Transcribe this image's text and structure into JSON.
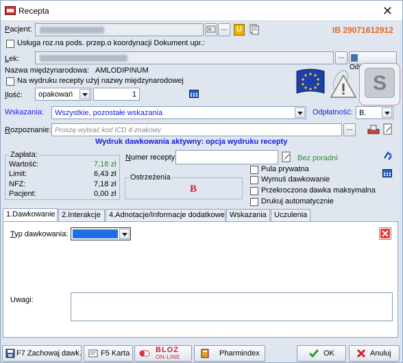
{
  "window": {
    "title": "Recepta",
    "close": "✕"
  },
  "header": {
    "patient_label": "Pacjent:",
    "patient_button": "...",
    "ib_number": "IB 29071612912",
    "usluga_label": "Usługa roz.na pods. przep.o koordynacji Dokument upr.:"
  },
  "drug": {
    "lek_label": "Lek:",
    "lek_button": "...",
    "odpowiedniki_label": "Odpowiedniki",
    "intl_name_label": "Nazwa międzynarodowa:",
    "intl_name_value": "AMLODIPINUM",
    "use_intl_label": "Na wydruku recepty użyj nazwy międzynarodowej",
    "ilosc_label": "Ilość:",
    "unit_value": "opakowań",
    "qty_value": "1",
    "s_badge": "S"
  },
  "indications": {
    "label": "Wskazania:",
    "value": "Wszystkie, pozostałe wskazania",
    "odplatnosc_label": "Odpłatność:",
    "odplatnosc_value": "B."
  },
  "diagnosis": {
    "label": "Rozpoznanie:",
    "placeholder": "Proszę wybrać kod ICD 4-znakowy",
    "button": "..."
  },
  "dosage_banner": "Wydruk dawkowania aktywny: opcja wydruku recepty",
  "payment": {
    "group_label": "Zapłata:",
    "rows": [
      {
        "label": "Wartość:",
        "value": "7,18 zł",
        "color": "#2c8a2c"
      },
      {
        "label": "Limit:",
        "value": "6,43 zł",
        "color": "#000000"
      },
      {
        "label": "NFZ:",
        "value": "7,18 zł",
        "color": "#000000"
      },
      {
        "label": "Pacjent:",
        "value": "0,00 zł",
        "color": "#000000"
      }
    ]
  },
  "prescription": {
    "numer_label": "Numer recepty:",
    "bez_poradni": "Bez poradni",
    "ostrzezenia_label": "Ostrzeżenia",
    "b_mark": "B",
    "options": [
      "Pula prywatna",
      "Wymuś dawkowanie",
      "Przekroczona dawka maksymalna",
      "Drukuj automatycznie"
    ]
  },
  "tabs": [
    {
      "label": "1.Dawkowanie",
      "active": true
    },
    {
      "label": "2.Interakcje",
      "active": false
    },
    {
      "label": "4.Adnotacje/Informacje dodatkowe",
      "active": false
    },
    {
      "label": "Wskazania",
      "active": false
    },
    {
      "label": "Uczulenia",
      "active": false
    }
  ],
  "dosage_panel": {
    "typ_label": "Typ dawkowania:",
    "uwagi_label": "Uwagi:"
  },
  "footer": {
    "f7": "F7 Zachowaj dawk.",
    "f5": "F5 Karta",
    "bloz_top": "BLOZ",
    "bloz_bottom": "ON-LINE",
    "pharmindex": "Pharmindex",
    "ok": "OK",
    "cancel": "Anuluj"
  },
  "colors": {
    "accent_orange": "#e8641b",
    "link_blue": "#1b1be0",
    "banner_blue": "#1a1ad8",
    "green_value": "#2c8a2c",
    "warning_red": "#d21f2b",
    "selection_blue": "#1e6fe0"
  },
  "icons": [
    "dropdown-arrow",
    "card-icon",
    "folder-icon",
    "eu-flag-icon",
    "pills-warning-icon",
    "calculator-icon",
    "edit-icon",
    "refresh-icon",
    "close-icon",
    "check-icon",
    "cross-icon",
    "disk-icon",
    "card-f5-icon",
    "pill-icon",
    "book-icon"
  ]
}
